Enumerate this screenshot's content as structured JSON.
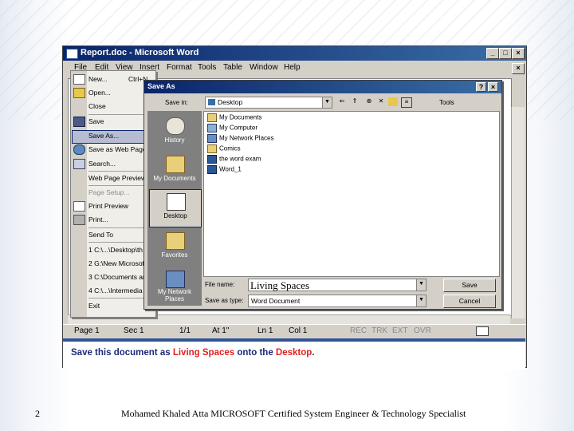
{
  "window": {
    "title": "Report.doc - Microsoft Word",
    "menu": [
      "File",
      "Edit",
      "View",
      "Insert",
      "Format",
      "Tools",
      "Table",
      "Window",
      "Help"
    ]
  },
  "file_menu": {
    "items": [
      {
        "label": "New...",
        "shortcut": "Ctrl+N"
      },
      {
        "label": "Open..."
      },
      {
        "label": "Close"
      },
      {
        "label": "Save"
      },
      {
        "label": "Save As..."
      },
      {
        "label": "Save as Web Page"
      },
      {
        "label": "Search..."
      },
      {
        "label": "Web Page Preview"
      },
      {
        "label": "Page Setup..."
      },
      {
        "label": "Print Preview"
      },
      {
        "label": "Print..."
      },
      {
        "label": "Send To"
      },
      {
        "label": "1 C:\\...\\Desktop\\th"
      },
      {
        "label": "2 G:\\New Microsoft"
      },
      {
        "label": "3 C:\\Documents an"
      },
      {
        "label": "4 C:\\...\\Intermedia"
      },
      {
        "label": "Exit"
      }
    ]
  },
  "save_dialog": {
    "title": "Save As",
    "save_in_label": "Save in:",
    "save_in_value": "Desktop",
    "tools_label": "Tools",
    "places": [
      "History",
      "My Documents",
      "Desktop",
      "Favorites",
      "My Network Places"
    ],
    "files": [
      "My Documents",
      "My Computer",
      "My Network Places",
      "Comics",
      "the word exam",
      "Word_1"
    ],
    "file_name_label": "File name:",
    "file_name_value": "Living Spaces",
    "save_type_label": "Save as type:",
    "save_type_value": "Word Document",
    "save_button": "Save",
    "cancel_button": "Cancel"
  },
  "status_bar": {
    "page": "Page 1",
    "sec": "Sec 1",
    "pages": "1/1",
    "at": "At 1\"",
    "ln": "Ln 1",
    "col": "Col 1",
    "rec": "REC",
    "trk": "TRK",
    "ext": "EXT",
    "ovr": "OVR"
  },
  "instruction": {
    "before": "Save this document as ",
    "doc_name": "Living Spaces",
    "middle": " onto the ",
    "location": "Desktop",
    "after": "."
  },
  "footer": {
    "slide_number": "2",
    "text": "Mohamed Khaled Atta MICROSOFT Certified System Engineer & Technology Specialist"
  },
  "colors": {
    "titlebar": "#0a246a",
    "instruction_text": "#1e2a78",
    "instruction_highlight": "#e02020"
  }
}
